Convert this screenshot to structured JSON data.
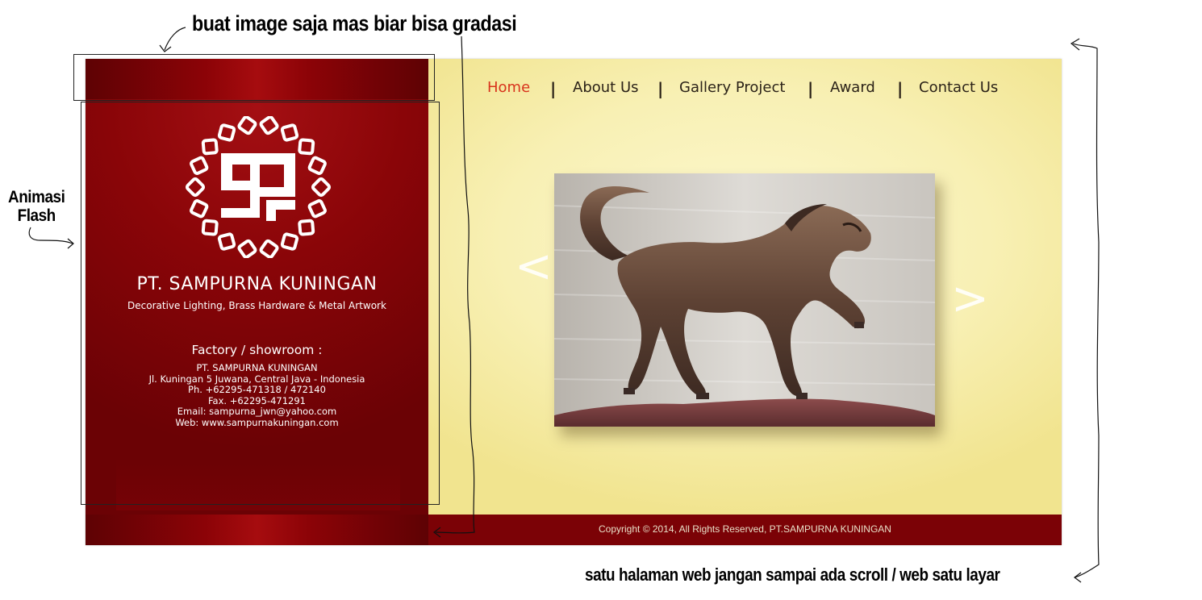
{
  "annotations": {
    "top_note": "buat image saja mas biar bisa gradasi",
    "flash_note": [
      "Animasi",
      "Flash"
    ],
    "bottom_note": "satu halaman web jangan sampai ada scroll / web satu layar"
  },
  "company": {
    "name": "PT. SAMPURNA KUNINGAN",
    "tagline": "Decorative Lighting, Brass Hardware & Metal Artwork",
    "factory_title": "Factory / showroom :",
    "address_lines": [
      "PT. SAMPURNA KUNINGAN",
      "Jl. Kuningan 5 Juwana, Central Java - Indonesia",
      "Ph. +62295-471318 / 472140",
      "Fax. +62295-471291",
      "Email: sampurna_jwn@yahoo.com",
      "Web: www.sampurnakuningan.com"
    ]
  },
  "nav": {
    "items": [
      {
        "label": "Home",
        "active": true
      },
      {
        "label": "About Us",
        "active": false
      },
      {
        "label": "Gallery Project",
        "active": false
      },
      {
        "label": "Award",
        "active": false
      },
      {
        "label": "Contact Us",
        "active": false
      }
    ],
    "separator": "|"
  },
  "slider": {
    "prev_label": "<",
    "next_label": ">",
    "image_subject": "bronze horse sculpture"
  },
  "footer": {
    "copyright": "Copyright © 2014, All Rights Reserved, PT.SAMPURNA KUNINGAN"
  },
  "colors": {
    "brand_red": "#8a0508",
    "footer_red": "#7b0206",
    "background_cream": "#f8f0b4",
    "nav_active": "#d8331c",
    "nav_text": "#2b2218"
  },
  "icons": {
    "logo": "sp-logo-icon",
    "prev": "chevron-left-icon",
    "next": "chevron-right-icon"
  }
}
